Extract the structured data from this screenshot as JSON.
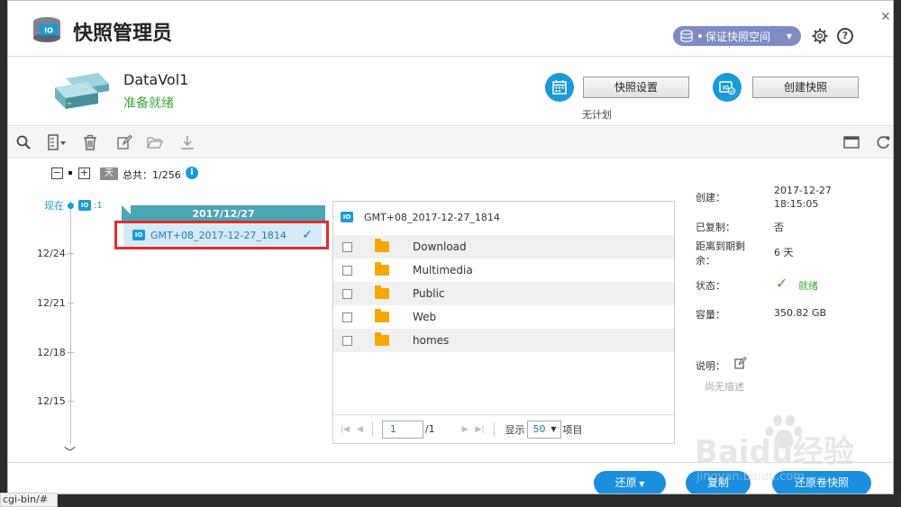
{
  "app": {
    "title": "快照管理员"
  },
  "header": {
    "space_button": "保证快照空间"
  },
  "volume": {
    "name": "DataVol1",
    "status": "准备就绪"
  },
  "actions": {
    "snapshot_settings": "快照设置",
    "create_snapshot": "创建快照",
    "schedule_status": "无计划"
  },
  "timeline": {
    "day_tag": "天",
    "total_label": "总共：1/256",
    "now_label": "现在",
    "now_count": ":1",
    "dates": [
      "12/24",
      "12/21",
      "12/18",
      "12/15"
    ],
    "date_header": "2017/12/27",
    "snapshot_name": "GMT+08_2017-12-27_1814"
  },
  "file_panel": {
    "title": "GMT+08_2017-12-27_1814",
    "files": [
      "Download",
      "Multimedia",
      "Public",
      "Web",
      "homes"
    ],
    "pager": {
      "page": "1",
      "total": "/1",
      "show_label": "显示",
      "per_page": "50",
      "items_label": "项目"
    }
  },
  "details": {
    "created_label": "创建：",
    "created_value_date": "2017-12-27",
    "created_value_time": "18:15:05",
    "copied_label": "已复制：",
    "copied_value": "否",
    "expire_label_1": "距离到期剩",
    "expire_label_2": "余：",
    "expire_value": "6 天",
    "status_label": "状态：",
    "status_value": "就绪",
    "capacity_label": "容量：",
    "capacity_value": "350.82 GB",
    "desc_label": "说明：",
    "desc_empty": "尚无描述"
  },
  "footer": {
    "restore": "还原",
    "copy": "复制",
    "revert": "还原卷快照"
  },
  "browser": {
    "status_url": "cgi-bin/#"
  },
  "watermark": {
    "brand": "Baidu经验",
    "url": "jingyan.baidu.com"
  },
  "colors": {
    "accent": "#1a9ad6",
    "pill": "#1a8fe0",
    "ok": "#3aaa35",
    "highlight": "#e32b2b",
    "teal": "#4aa5b5"
  }
}
